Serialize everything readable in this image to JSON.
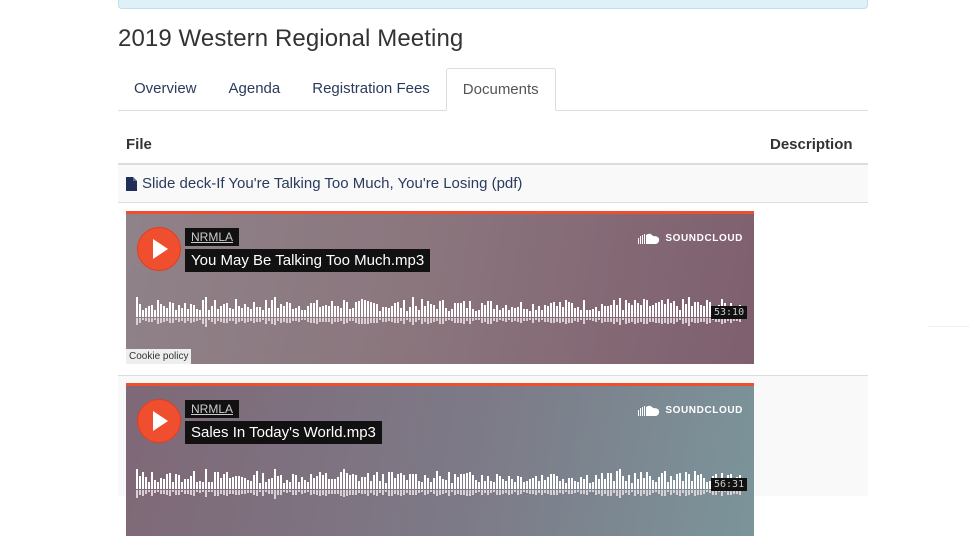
{
  "page": {
    "title": "2019 Western Regional Meeting"
  },
  "tabs": [
    {
      "label": "Overview",
      "active": false
    },
    {
      "label": "Agenda",
      "active": false
    },
    {
      "label": "Registration Fees",
      "active": false
    },
    {
      "label": "Documents",
      "active": true
    }
  ],
  "table": {
    "headers": {
      "file": "File",
      "description": "Description"
    },
    "file_row": {
      "link_text": "Slide deck-If You're Talking Too Much, You're Losing (pdf)",
      "icon": "document-icon"
    }
  },
  "players": [
    {
      "artist": "NRMLA",
      "track": "You May Be Talking Too Much.mp3",
      "duration": "53:10",
      "brand": "SOUNDCLOUD",
      "cookie_label": "Cookie policy"
    },
    {
      "artist": "NRMLA",
      "track": "Sales In Today's World.mp3",
      "duration": "56:31",
      "brand": "SOUNDCLOUD"
    }
  ],
  "colors": {
    "accent": "#f04f2f",
    "link": "#2a3b5c",
    "info_bg": "#dff0f7"
  }
}
